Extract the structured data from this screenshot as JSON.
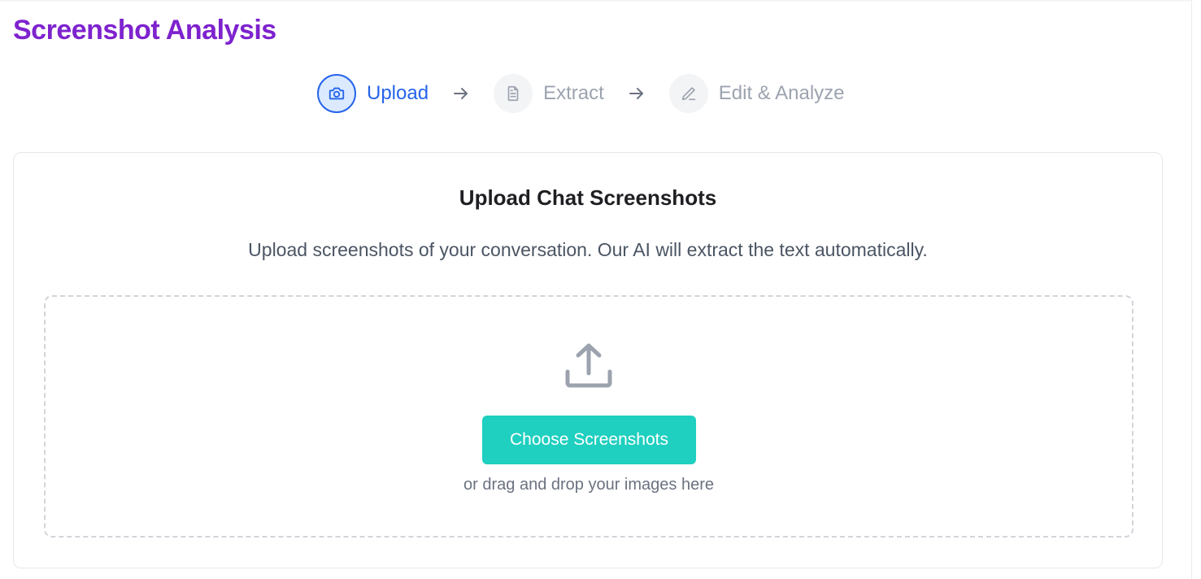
{
  "page": {
    "title": "Screenshot Analysis"
  },
  "stepper": {
    "steps": [
      {
        "label": "Upload",
        "icon": "camera-icon",
        "active": true
      },
      {
        "label": "Extract",
        "icon": "document-icon",
        "active": false
      },
      {
        "label": "Edit & Analyze",
        "icon": "pencil-icon",
        "active": false
      }
    ]
  },
  "upload_card": {
    "title": "Upload Chat Screenshots",
    "subtitle": "Upload screenshots of your conversation. Our AI will extract the text automatically.",
    "dropzone": {
      "icon": "upload-icon",
      "button_label": "Choose Screenshots",
      "hint": "or drag and drop your images here"
    }
  },
  "colors": {
    "title_purple": "#7e22ce",
    "active_blue": "#2563eb",
    "inactive_gray": "#9ca3af",
    "button_teal": "#1fcfbf"
  }
}
